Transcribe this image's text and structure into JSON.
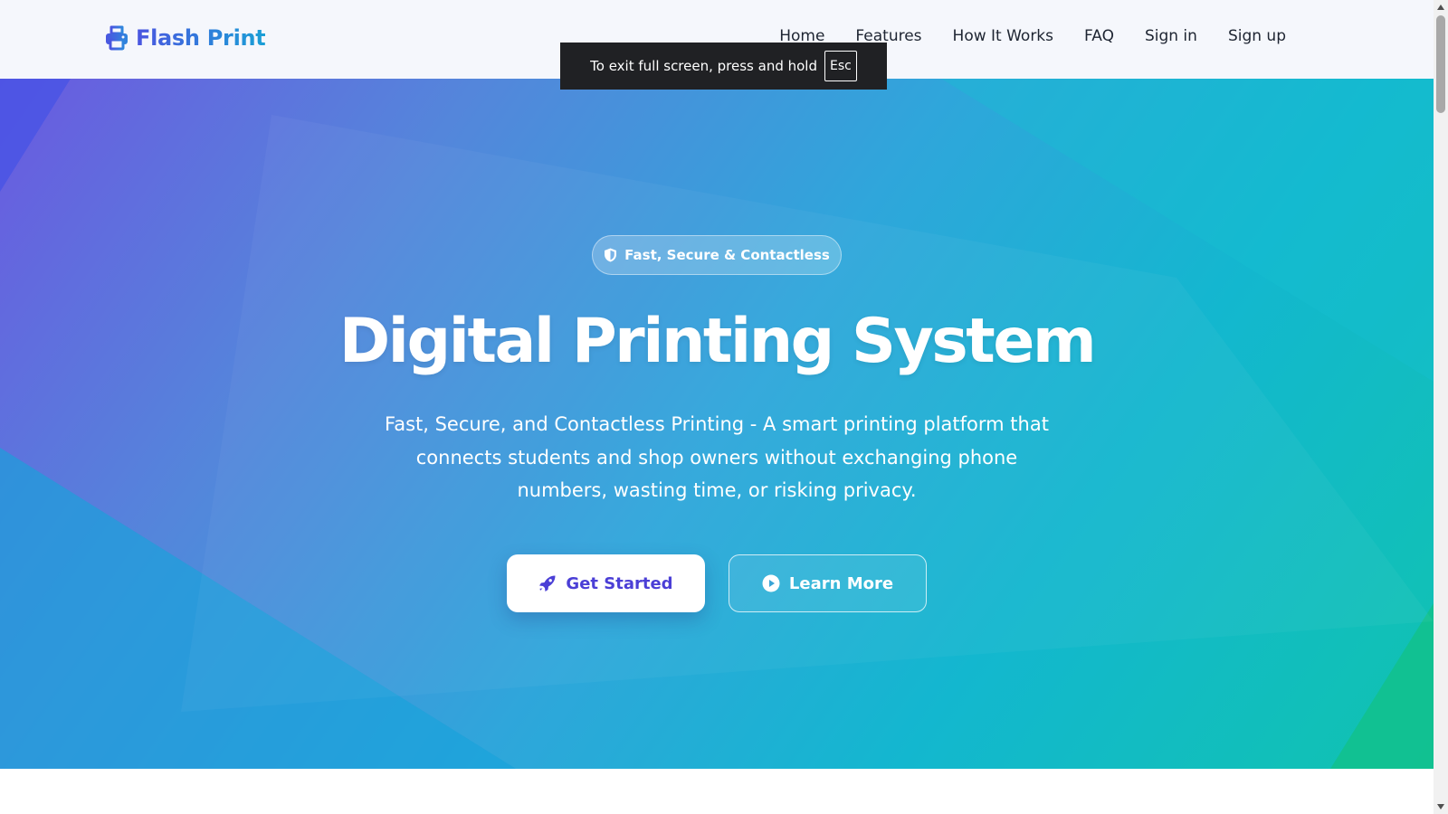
{
  "navbar": {
    "brand": "Flash Print",
    "brand_icon": "printer-icon",
    "links": [
      "Home",
      "Features",
      "How It Works",
      "FAQ",
      "Sign in",
      "Sign up"
    ]
  },
  "fullscreen_toast": {
    "message": "To exit full screen, press and hold",
    "key": "Esc"
  },
  "hero": {
    "badge_icon": "shield-icon",
    "badge": "Fast, Secure & Contactless",
    "title": "Digital Printing System",
    "subtitle": "Fast, Secure, and Contactless Printing - A smart printing platform that connects students and shop owners without exchanging phone numbers, wasting time, or risking privacy.",
    "primary_button": {
      "label": "Get Started",
      "icon": "rocket-icon"
    },
    "secondary_button": {
      "label": "Learn More",
      "icon": "play-circle-icon"
    }
  },
  "colors": {
    "brand_gradient_start": "#4a55e0",
    "brand_gradient_end": "#1a9fd6",
    "hero_gradient_start": "#6a5ae0",
    "hero_gradient_end": "#10c3b0",
    "primary_button_text": "#4b3fd6",
    "nav_text": "#1e2532",
    "toast_background": "#202124"
  }
}
